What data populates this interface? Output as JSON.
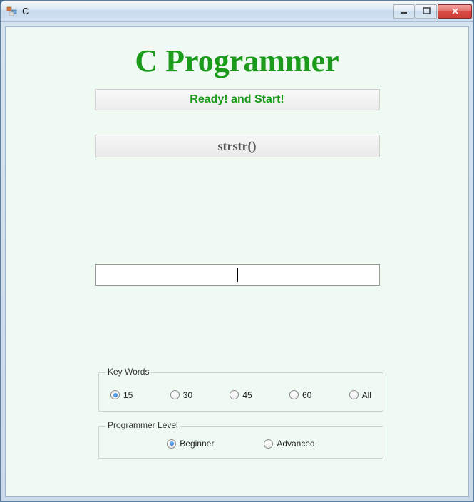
{
  "window": {
    "title": "C"
  },
  "header": {
    "title": "C Programmer"
  },
  "status": {
    "text": "Ready! and Start!"
  },
  "prompt": {
    "text": "strstr()"
  },
  "input": {
    "value": ""
  },
  "keywords": {
    "legend": "Key Words",
    "options": [
      "15",
      "30",
      "45",
      "60",
      "All"
    ],
    "selected": "15"
  },
  "level": {
    "legend": "Programmer Level",
    "options": [
      "Beginner",
      "Advanced"
    ],
    "selected": "Beginner"
  }
}
